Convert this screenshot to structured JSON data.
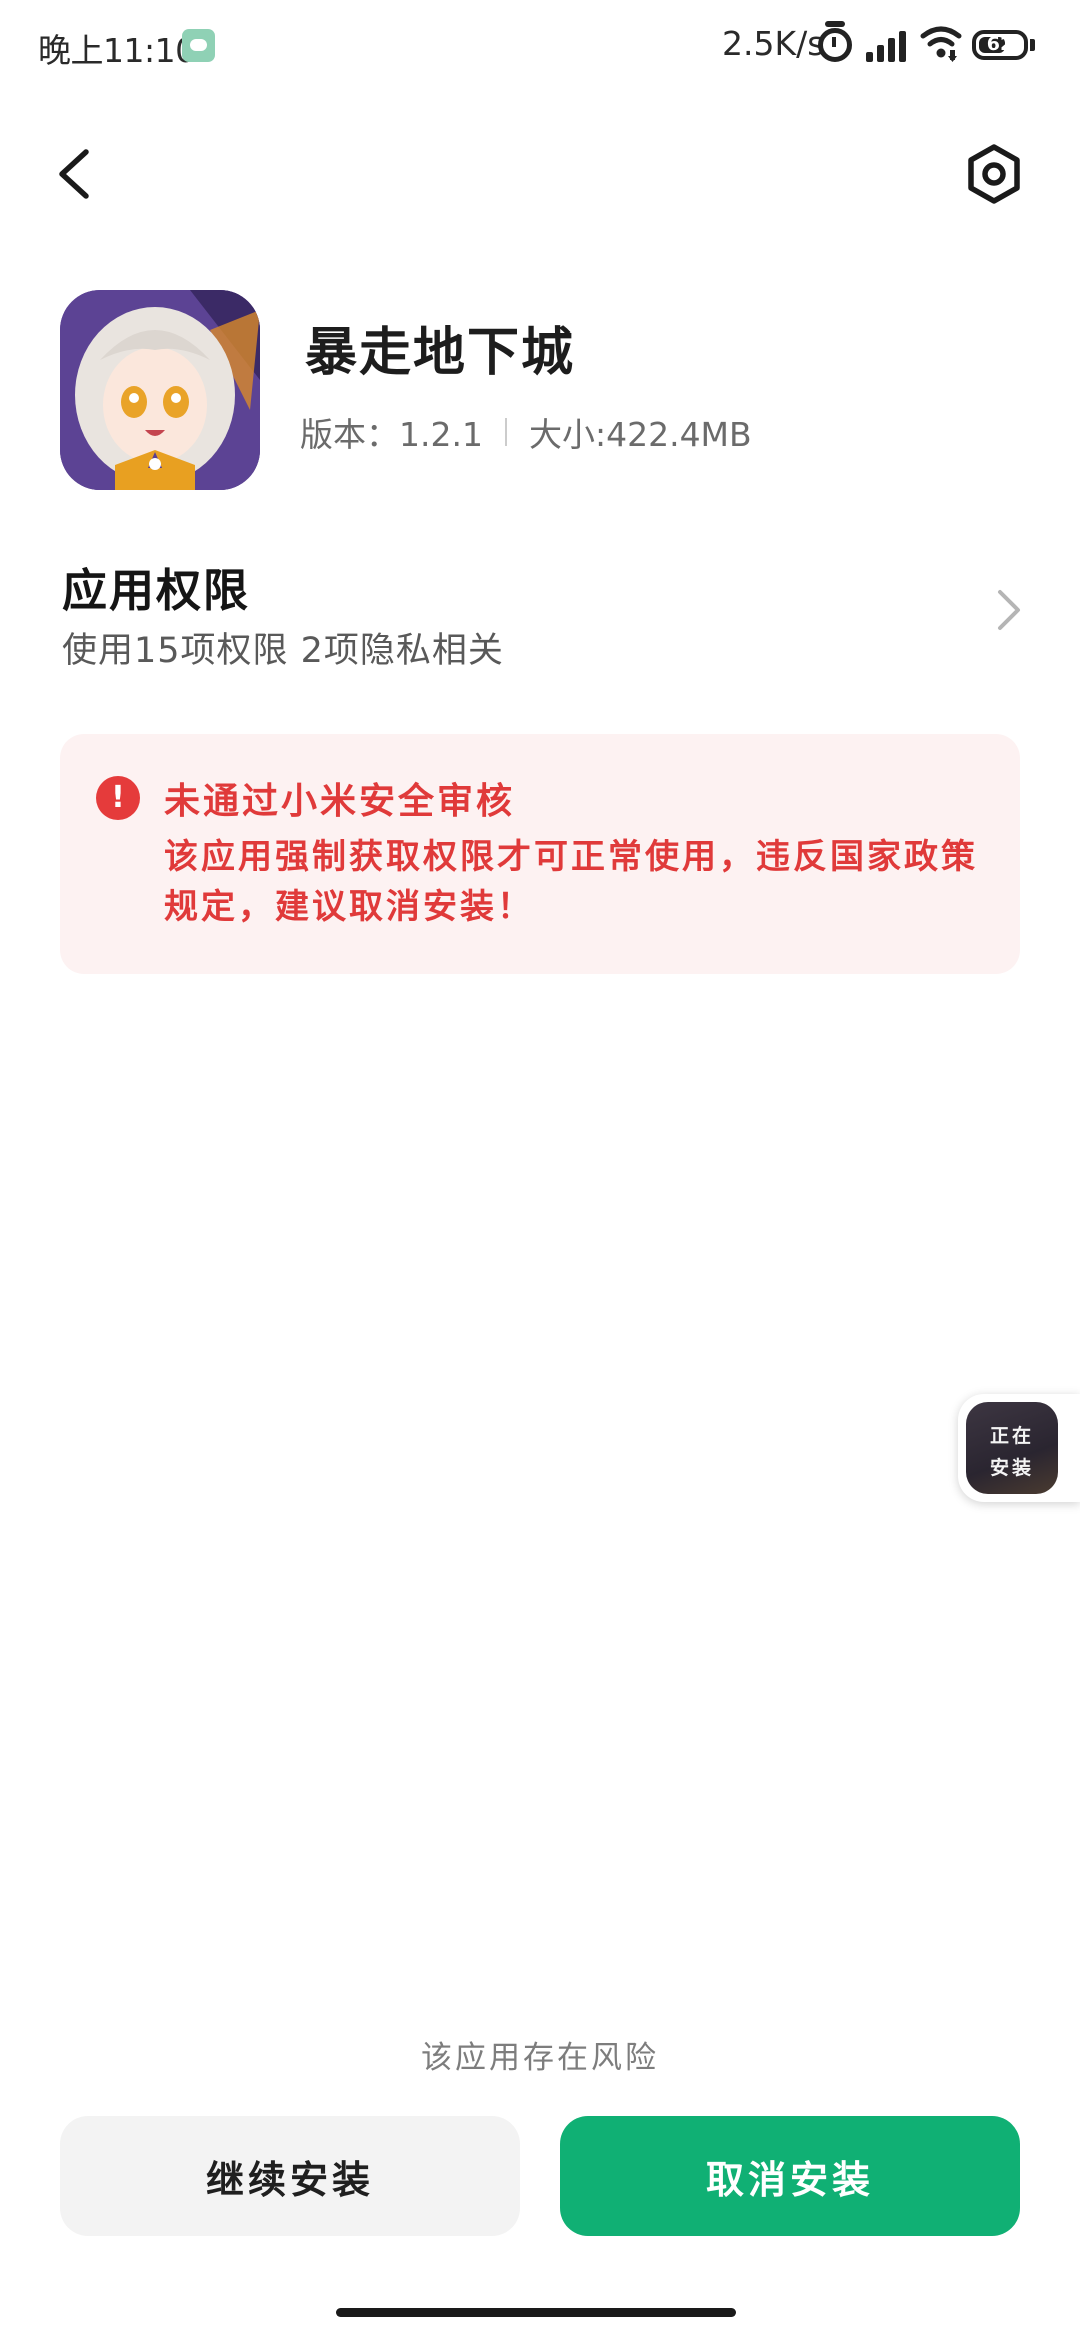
{
  "status_bar": {
    "time": "晚上11:10",
    "network_speed": "2.5K/s",
    "battery_level": "62",
    "battery_fraction": 0.62,
    "icons": [
      "wechat-notification-icon",
      "alarm-icon",
      "signal-icon",
      "wifi-icon",
      "battery-icon"
    ]
  },
  "nav": {
    "back_icon": "chevron-left-icon",
    "settings_icon": "settings-icon"
  },
  "app": {
    "name": "暴走地下城",
    "version_label": "版本：1.2.1",
    "size_label": "大小:422.4MB"
  },
  "permissions": {
    "title": "应用权限",
    "subtitle": "使用15项权限  2项隐私相关"
  },
  "warning": {
    "icon": "!",
    "title": "未通过小米安全审核",
    "description": "该应用强制获取权限才可正常使用，违反国家政策规定，建议取消安装！"
  },
  "installing_badge": {
    "line1": "正在",
    "line2": "安装"
  },
  "footer": {
    "risk_text": "该应用存在风险",
    "continue_label": "继续安装",
    "cancel_label": "取消安装"
  },
  "colors": {
    "accent_green": "#10b074",
    "warning_red": "#e03a3a",
    "warning_bg": "#fdf2f2"
  }
}
